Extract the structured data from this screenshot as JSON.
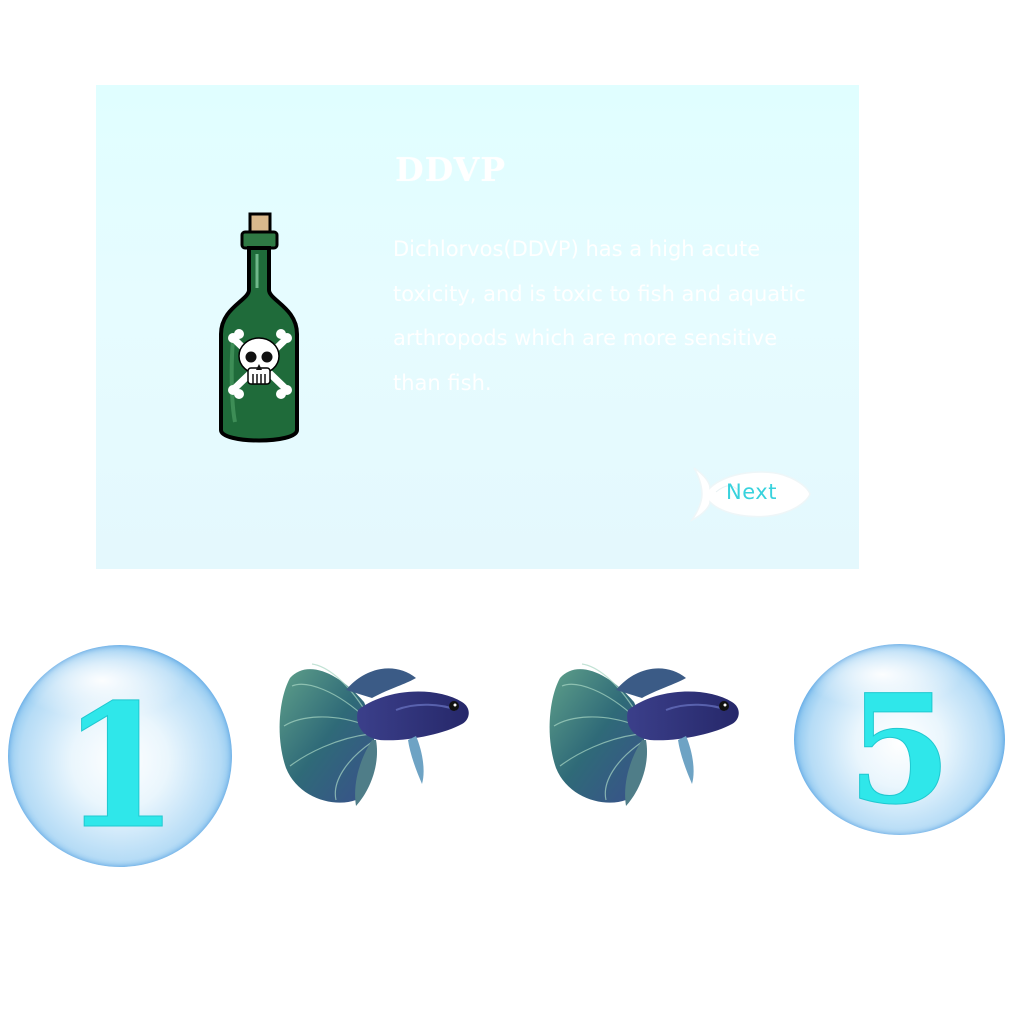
{
  "card": {
    "title": "DDVP",
    "body": "Dichlorvos(DDVP) has a high acute toxicity, and is toxic to fish and aquatic arthropods which are more sensitive than fish.",
    "next_label": "Next",
    "icon": "poison-bottle-icon"
  },
  "bubbles": {
    "left_number": "1",
    "right_number": "5"
  },
  "fish": {
    "icon": "betta-fish-icon",
    "count": 2
  },
  "colors": {
    "card_background": "#e2fcff",
    "number_color": "#2fe7ea",
    "next_text": "#38d2dd",
    "bottle_green": "#1f6b3a"
  }
}
